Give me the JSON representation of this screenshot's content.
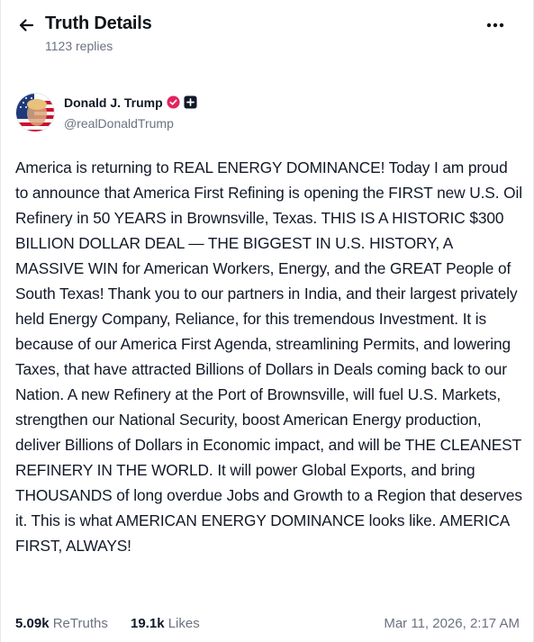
{
  "header": {
    "title": "Truth Details",
    "replies_label": "1123 replies",
    "back_icon": "arrow-left-icon",
    "more_icon": "ellipsis-icon"
  },
  "author": {
    "name": "Donald J. Trump",
    "handle": "@realDonaldTrump",
    "verified_badge_icon": "verified-badge-icon",
    "follow_icon": "plus-square-icon",
    "verified_color": "#e0245e"
  },
  "post": {
    "text": "America is returning to REAL ENERGY DOMINANCE! Today I am proud to announce that America First Refining is opening the FIRST new U.S. Oil Refinery in 50 YEARS in Brownsville, Texas. THIS IS A HISTORIC $300 BILLION DOLLAR DEAL — THE BIGGEST IN U.S. HISTORY, A MASSIVE WIN for American Workers, Energy, and the GREAT People of South Texas! Thank you to our partners in India, and their largest privately held Energy Company, Reliance, for this tremendous Investment. It is because of our America First Agenda, streamlining Permits, and lowering Taxes, that have attracted Billions of Dollars in Deals coming back to our Nation. A new Refinery at the Port of Brownsville, will fuel U.S. Markets, strengthen our National Security, boost American Energy production, deliver Billions of Dollars in Economic impact, and will be THE CLEANEST REFINERY IN THE WORLD. It will power Global Exports, and bring THOUSANDS of long overdue Jobs and Growth to a Region that deserves it. This is what AMERICAN ENERGY DOMINANCE looks like. AMERICA FIRST, ALWAYS!"
  },
  "stats": {
    "retruths_count": "5.09k",
    "retruths_label": "ReTruths",
    "likes_count": "19.1k",
    "likes_label": "Likes",
    "timestamp": "Mar 11, 2026, 2:17 AM"
  }
}
